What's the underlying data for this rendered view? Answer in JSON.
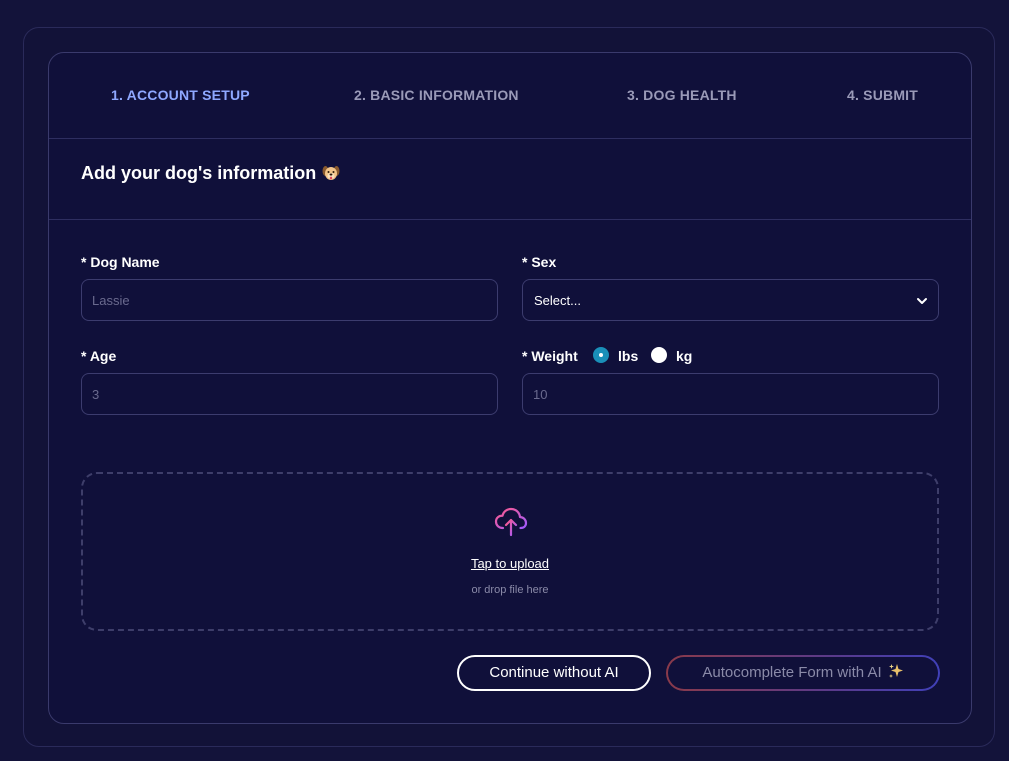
{
  "steps": [
    {
      "label": "1. ACCOUNT SETUP",
      "active": true
    },
    {
      "label": "2. BASIC INFORMATION",
      "active": false
    },
    {
      "label": "3. DOG HEALTH",
      "active": false
    },
    {
      "label": "4. SUBMIT",
      "active": false
    }
  ],
  "heading": {
    "title": "Add your dog's information",
    "emoji_icon": "dog-face-icon"
  },
  "form": {
    "dog_name": {
      "label": "* Dog Name",
      "placeholder": "Lassie",
      "value": ""
    },
    "sex": {
      "label": "* Sex",
      "selected": "Select..."
    },
    "age": {
      "label": "* Age",
      "placeholder": "3",
      "value": ""
    },
    "weight": {
      "label": "* Weight",
      "placeholder": "10",
      "value": "",
      "units": [
        {
          "label": "lbs",
          "checked": true
        },
        {
          "label": "kg",
          "checked": false
        }
      ]
    }
  },
  "upload": {
    "link_text": "Tap to upload",
    "hint": "or drop file here",
    "icon": "cloud-upload-icon"
  },
  "buttons": {
    "continue_label": "Continue without AI",
    "ai_label": "Autocomplete Form with AI",
    "ai_icon": "sparkle-icon"
  },
  "colors": {
    "background": "#13133a",
    "card": "#10103a",
    "active_step": "#8fa8ff",
    "radio_checked": "#1a8fb8"
  }
}
